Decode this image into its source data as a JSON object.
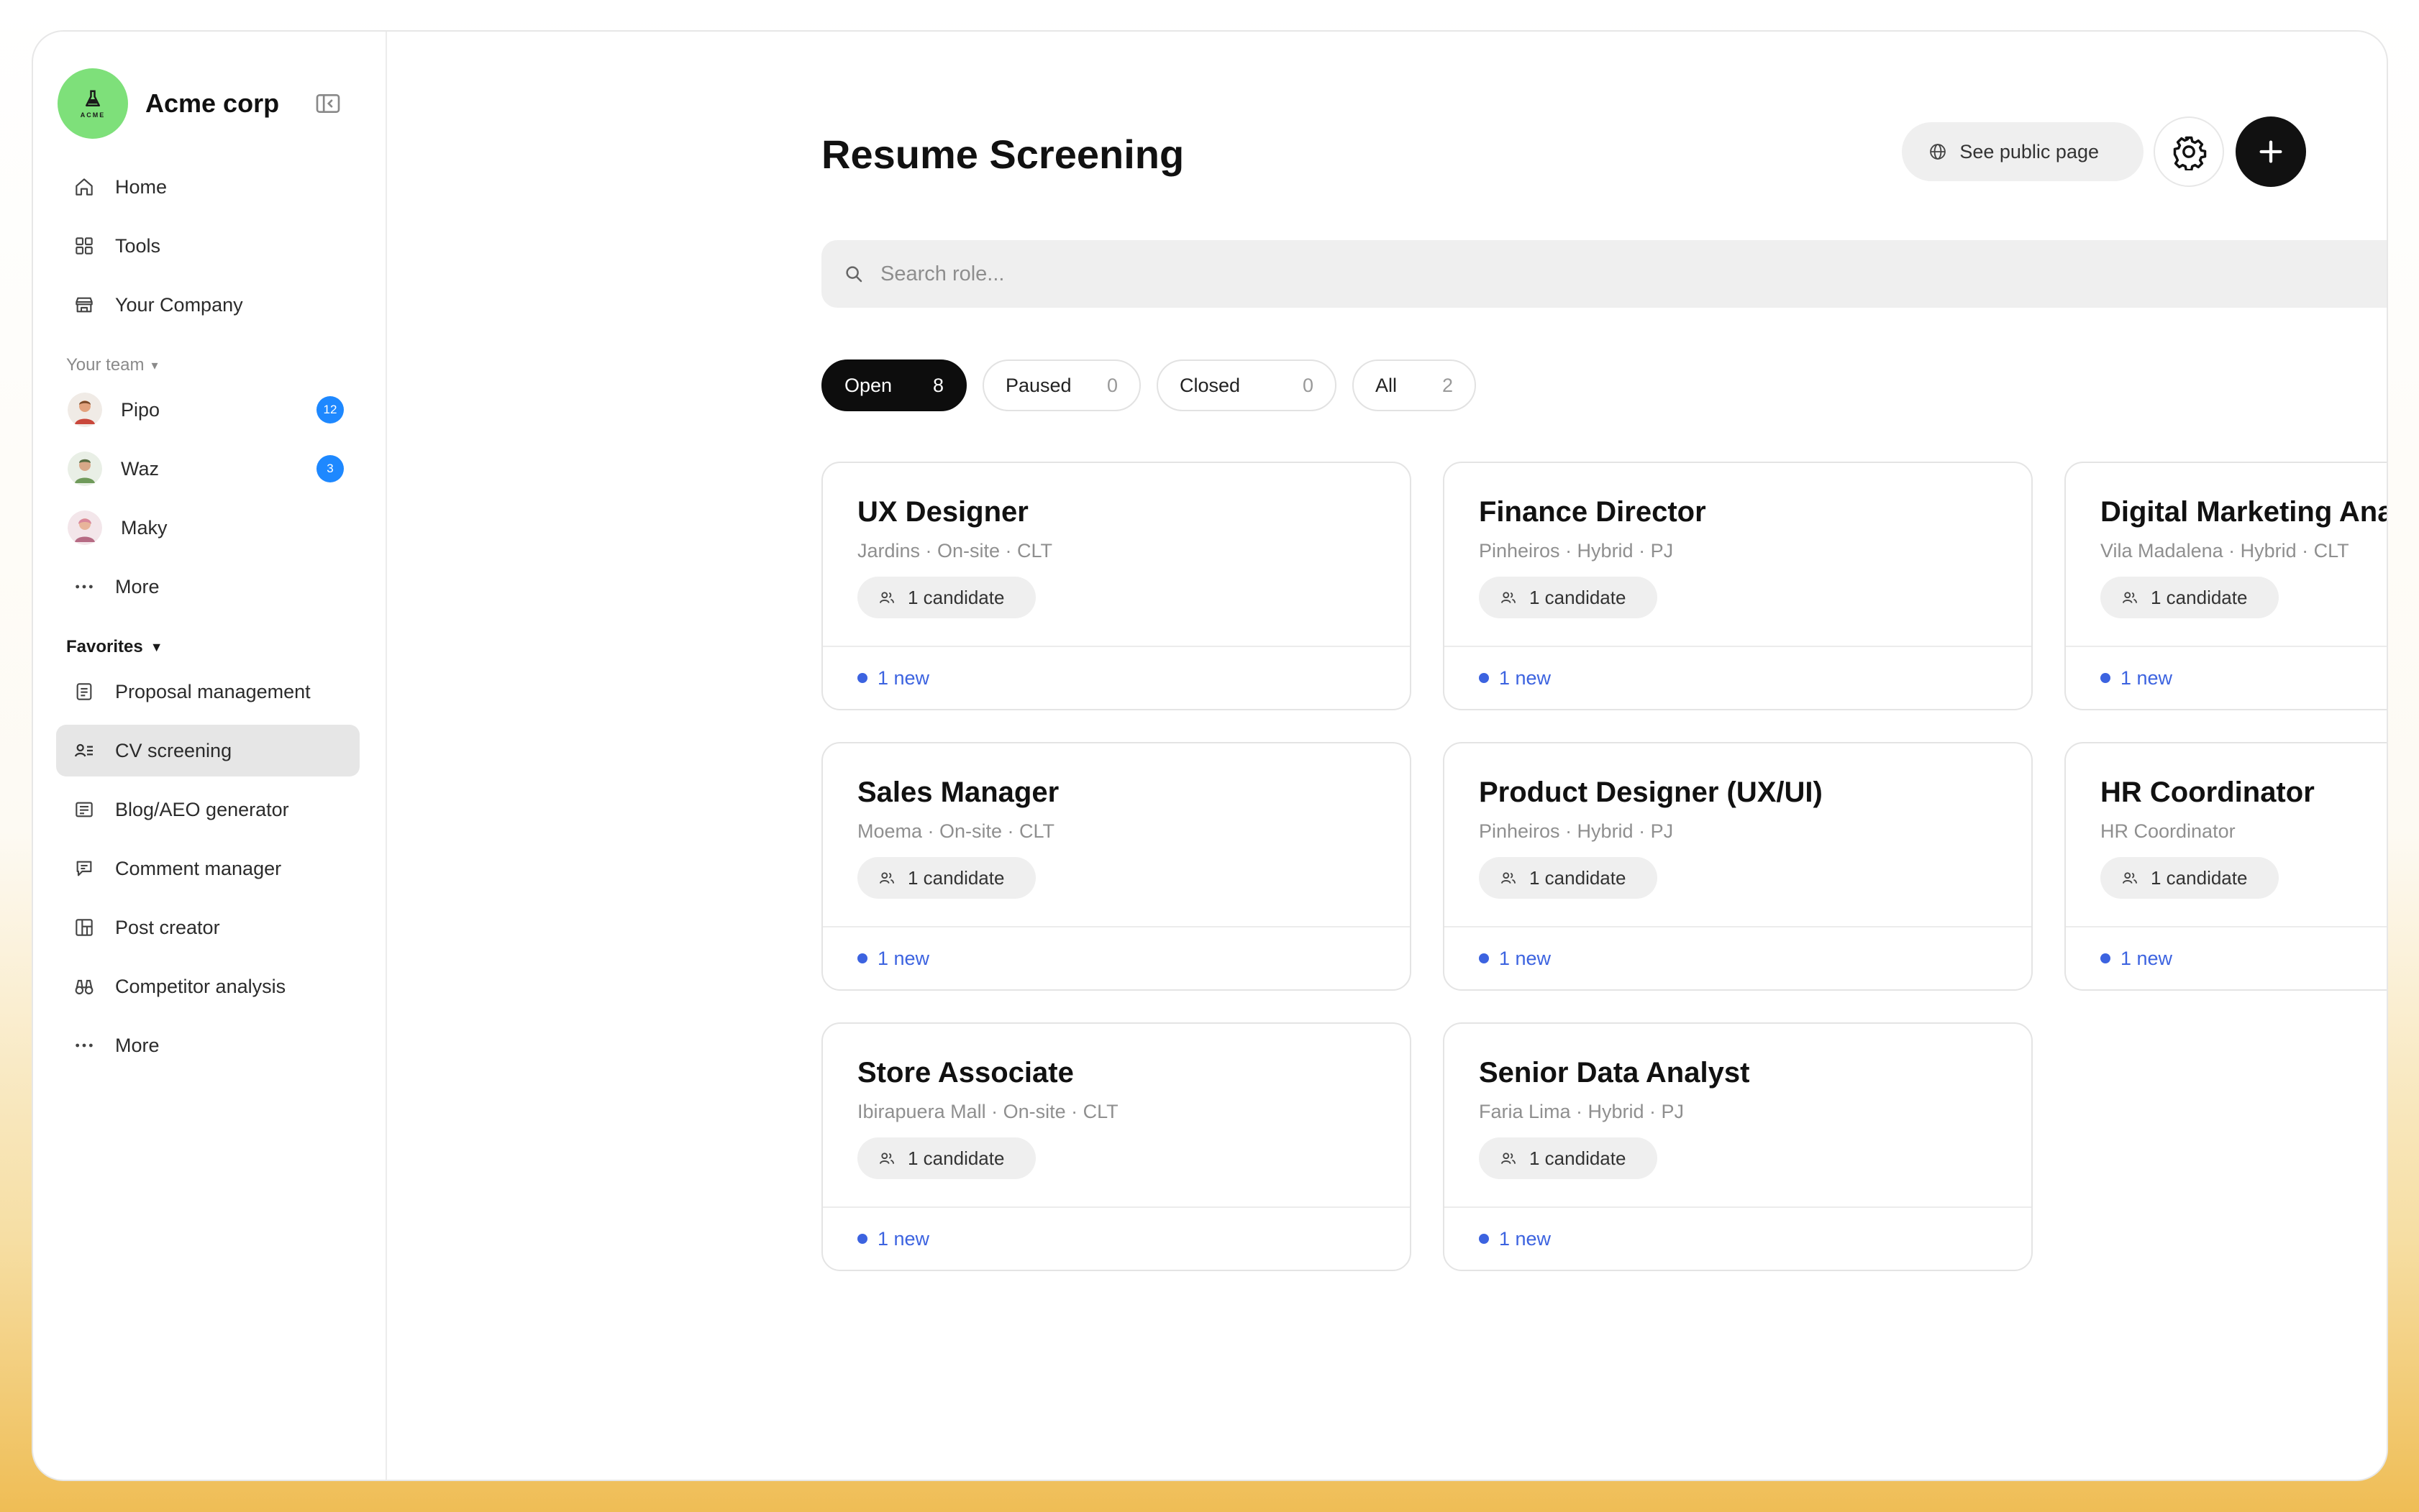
{
  "brand": {
    "name": "Acme corp",
    "logo_text": "ACME"
  },
  "nav": [
    {
      "label": "Home",
      "icon": "home-icon"
    },
    {
      "label": "Tools",
      "icon": "grid-icon"
    },
    {
      "label": "Your Company",
      "icon": "store-icon"
    }
  ],
  "team": {
    "title": "Your team",
    "members": [
      {
        "name": "Pipo",
        "badge": "12"
      },
      {
        "name": "Waz",
        "badge": "3"
      },
      {
        "name": "Maky",
        "badge": ""
      }
    ],
    "more": "More"
  },
  "favorites": {
    "title": "Favorites",
    "items": [
      {
        "label": "Proposal management",
        "icon": "document-icon"
      },
      {
        "label": "CV screening",
        "icon": "contact-list-icon",
        "active": true
      },
      {
        "label": "Blog/AEO generator",
        "icon": "article-icon"
      },
      {
        "label": "Comment manager",
        "icon": "comment-icon"
      },
      {
        "label": "Post creator",
        "icon": "layout-icon"
      },
      {
        "label": "Competitor analysis",
        "icon": "binoculars-icon"
      }
    ],
    "more": "More"
  },
  "header": {
    "title": "Resume Screening",
    "public_page_label": "See public page"
  },
  "search": {
    "placeholder": "Search role..."
  },
  "filters": [
    {
      "label": "Open",
      "count": "8",
      "active": true
    },
    {
      "label": "Paused",
      "count": "0"
    },
    {
      "label": "Closed",
      "count": "0"
    },
    {
      "label": "All",
      "count": "2"
    }
  ],
  "jobs": [
    {
      "title": "UX Designer",
      "subtitle": "Jardins · On-site · CLT",
      "candidates": "1 candidate",
      "new": "1 new"
    },
    {
      "title": "Finance Director",
      "subtitle": "Pinheiros · Hybrid · PJ",
      "candidates": "1 candidate",
      "new": "1 new"
    },
    {
      "title": "Digital Marketing Analyst",
      "subtitle": "Vila Madalena · Hybrid · CLT",
      "candidates": "1 candidate",
      "new": "1 new"
    },
    {
      "title": "Sales Manager",
      "subtitle": "Moema · On-site · CLT",
      "candidates": "1 candidate",
      "new": "1 new"
    },
    {
      "title": "Product Designer (UX/UI)",
      "subtitle": "Pinheiros · Hybrid · PJ",
      "candidates": "1 candidate",
      "new": "1 new"
    },
    {
      "title": "HR Coordinator",
      "subtitle": "HR Coordinator",
      "candidates": "1 candidate",
      "new": "1 new"
    },
    {
      "title": "Store Associate",
      "subtitle": "Ibirapuera Mall · On-site · CLT",
      "candidates": "1 candidate",
      "new": "1 new"
    },
    {
      "title": "Senior Data Analyst",
      "subtitle": "Faria Lima · Hybrid · PJ",
      "candidates": "1 candidate",
      "new": "1 new"
    }
  ],
  "colors": {
    "accent": "#3c63e0",
    "badge": "#1e88ff",
    "brand": "#7ee07a"
  }
}
